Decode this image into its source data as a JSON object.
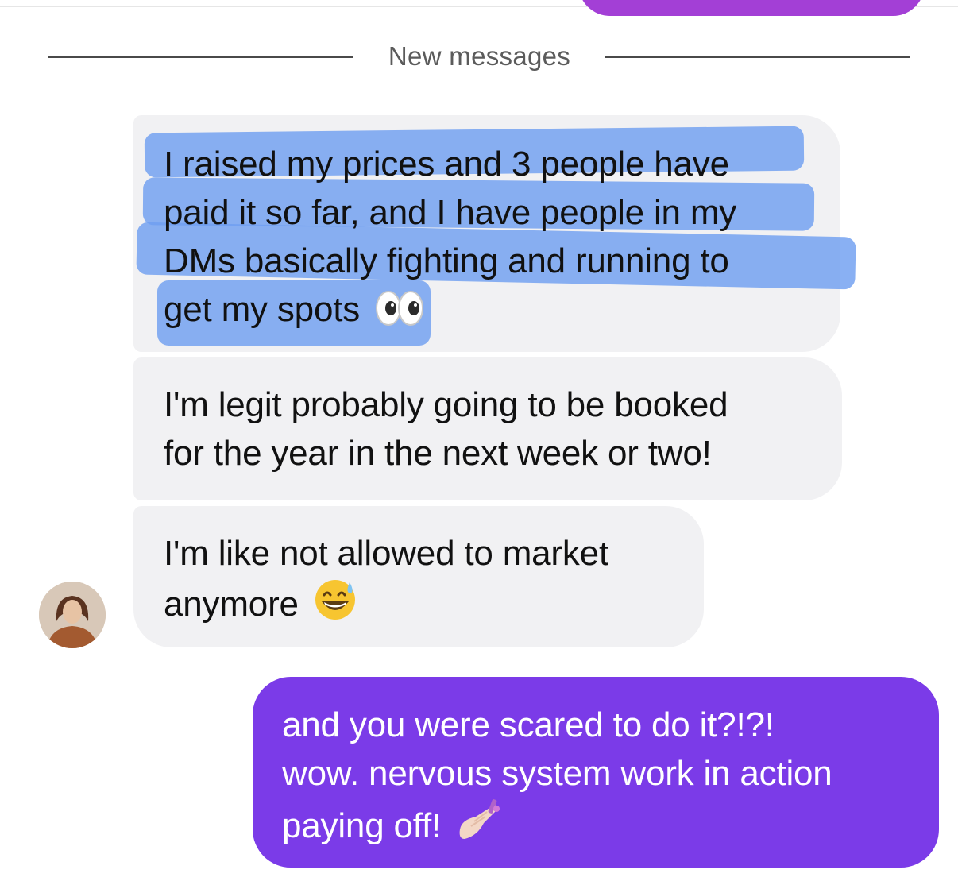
{
  "divider": {
    "label": "New messages"
  },
  "messages": [
    {
      "sender": "contact",
      "lines": [
        "I raised my prices and 3 people have",
        "paid it so far, and I have people in my",
        "DMs basically fighting and running to",
        "get my spots"
      ],
      "emoji": "eyes-emoji",
      "highlighted": true
    },
    {
      "sender": "contact",
      "lines": [
        "I'm legit probably going to be booked",
        "for the year in the next week or two!"
      ]
    },
    {
      "sender": "contact",
      "lines": [
        "I'm like not allowed to market",
        "anymore"
      ],
      "emoji": "grinning-face-with-sweat-emoji"
    },
    {
      "sender": "me",
      "lines": [
        "and you were scared to do it?!?!",
        "wow. nervous system work in action",
        "paying off!"
      ],
      "emoji": "nail-polish-emoji"
    }
  ],
  "colors": {
    "incoming_bubble": "#f1f1f3",
    "outgoing_bubble": "#7b3be8",
    "previous_bubble": "#a33fd6",
    "highlight": "#6f9ff0"
  }
}
